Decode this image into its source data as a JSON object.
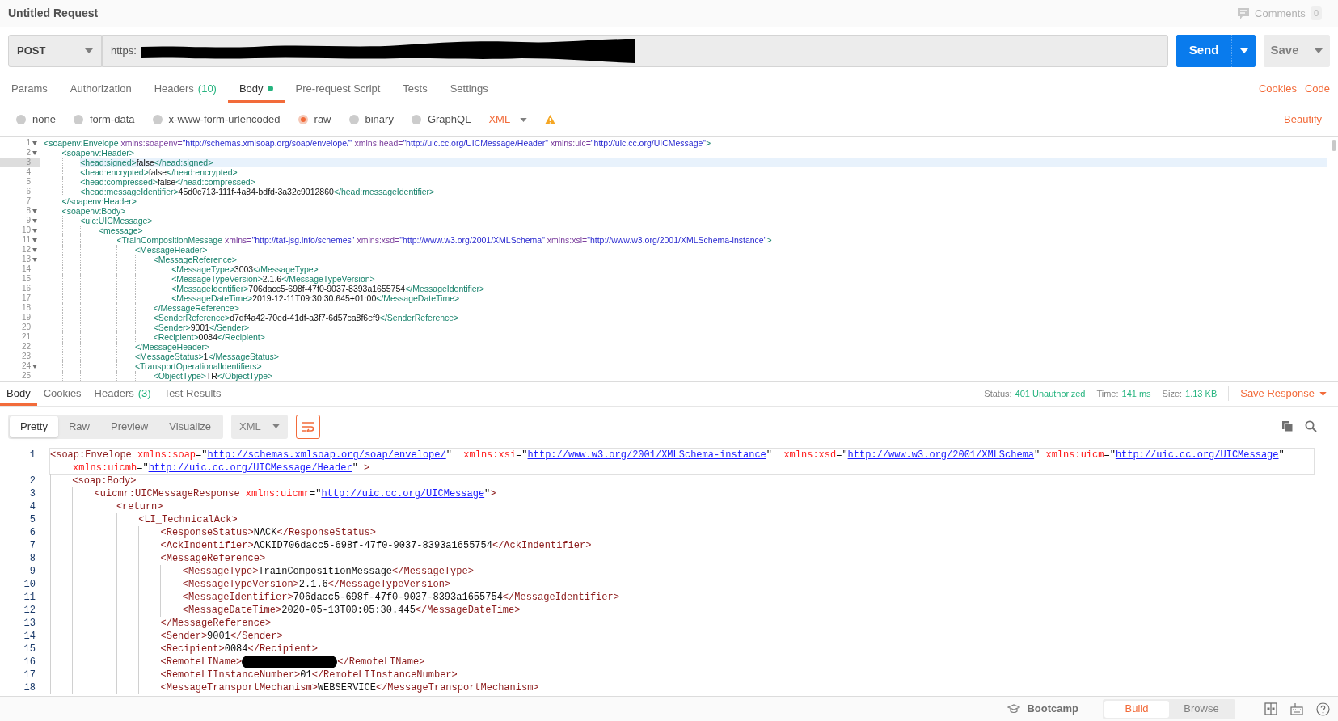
{
  "title": "Untitled Request",
  "comments": {
    "label": "Comments",
    "count": "0"
  },
  "request": {
    "method": "POST",
    "url": {
      "value": "https:",
      "redacted": true
    },
    "send": "Send",
    "save": "Save"
  },
  "tabs": [
    {
      "label": "Params",
      "selected": false
    },
    {
      "label": "Authorization",
      "selected": false
    },
    {
      "label": "Headers",
      "count": "(10)",
      "selected": false
    },
    {
      "label": "Body",
      "dot": true,
      "selected": true
    },
    {
      "label": "Pre-request Script",
      "selected": false
    },
    {
      "label": "Tests",
      "selected": false
    },
    {
      "label": "Settings",
      "selected": false
    }
  ],
  "tab_links": [
    "Cookies",
    "Code"
  ],
  "body_modes": [
    {
      "label": "none",
      "selected": false
    },
    {
      "label": "form-data",
      "selected": false
    },
    {
      "label": "x-www-form-urlencoded",
      "selected": false
    },
    {
      "label": "raw",
      "selected": true
    },
    {
      "label": "binary",
      "selected": false
    },
    {
      "label": "GraphQL",
      "selected": false
    }
  ],
  "body_format": "XML",
  "beautify": "Beautify",
  "request_code": [
    {
      "n": "1",
      "selected": false,
      "expanded": true,
      "parts": [
        {
          "kind": "tag",
          "text": "<soapenv:Envelope"
        },
        {
          "kind": "attr",
          "text": " xmlns:soapenv="
        },
        {
          "kind": "str",
          "text": "\"http://schemas.xmlsoap.org/soap/envelope/\""
        },
        {
          "kind": "attr",
          "text": " xmlns:head="
        },
        {
          "kind": "str",
          "text": "\"http://uic.cc.org/UICMessage/Header\""
        },
        {
          "kind": "attr",
          "text": " xmlns:uic="
        },
        {
          "kind": "str",
          "text": "\"http://uic.cc.org/UICMessage\""
        },
        {
          "kind": "tag",
          "text": ">"
        }
      ],
      "children": [
        {
          "n": "2",
          "selected": false,
          "expanded": true,
          "parts": [
            {
              "kind": "tag",
              "text": "<soapenv:Header>"
            }
          ],
          "children": [
            {
              "n": "3",
              "selected": true,
              "parts": [
                {
                  "kind": "tag",
                  "text": "<head:signed>"
                },
                {
                  "kind": "text",
                  "text": "false"
                },
                {
                  "kind": "tag",
                  "text": "</head:signed>"
                }
              ]
            },
            {
              "n": "4",
              "selected": false,
              "parts": [
                {
                  "kind": "tag",
                  "text": "<head:encrypted>"
                },
                {
                  "kind": "text",
                  "text": "false"
                },
                {
                  "kind": "tag",
                  "text": "</head:encrypted>"
                }
              ]
            },
            {
              "n": "5",
              "selected": false,
              "parts": [
                {
                  "kind": "tag",
                  "text": "<head:compressed>"
                },
                {
                  "kind": "text",
                  "text": "false"
                },
                {
                  "kind": "tag",
                  "text": "</head:compressed>"
                }
              ]
            },
            {
              "n": "6",
              "selected": false,
              "parts": [
                {
                  "kind": "tag",
                  "text": "<head:messageIdentifier>"
                },
                {
                  "kind": "text",
                  "text": "45d0c713-111f-4a84-bdfd-3a32c9012860"
                },
                {
                  "kind": "tag",
                  "text": "</head:messageIdentifier>"
                }
              ]
            }
          ]
        },
        {
          "n": "7",
          "selected": false,
          "parts": [
            {
              "kind": "tag",
              "text": "</soapenv:Header>"
            }
          ]
        },
        {
          "n": "8",
          "selected": false,
          "expanded": true,
          "parts": [
            {
              "kind": "tag",
              "text": "<soapenv:Body>"
            }
          ],
          "children": [
            {
              "n": "9",
              "selected": false,
              "expanded": true,
              "parts": [
                {
                  "kind": "tag",
                  "text": "<uic:UICMessage>"
                }
              ],
              "children": [
                {
                  "n": "10",
                  "selected": false,
                  "expanded": true,
                  "parts": [
                    {
                      "kind": "tag",
                      "text": "<message>"
                    }
                  ],
                  "children": [
                    {
                      "n": "11",
                      "selected": false,
                      "expanded": true,
                      "parts": [
                        {
                          "kind": "tag",
                          "text": "<TrainCompositionMessage"
                        },
                        {
                          "kind": "attr",
                          "text": " xmlns="
                        },
                        {
                          "kind": "str",
                          "text": "\"http://taf-jsg.info/schemes\""
                        },
                        {
                          "kind": "attr",
                          "text": " xmlns:xsd="
                        },
                        {
                          "kind": "str",
                          "text": "\"http://www.w3.org/2001/XMLSchema\""
                        },
                        {
                          "kind": "attr",
                          "text": " xmlns:xsi="
                        },
                        {
                          "kind": "str",
                          "text": "\"http://www.w3.org/2001/XMLSchema-instance\""
                        },
                        {
                          "kind": "tag",
                          "text": ">"
                        }
                      ],
                      "children": [
                        {
                          "n": "12",
                          "selected": false,
                          "expanded": true,
                          "parts": [
                            {
                              "kind": "tag",
                              "text": "<MessageHeader>"
                            }
                          ],
                          "children": [
                            {
                              "n": "13",
                              "selected": false,
                              "expanded": true,
                              "parts": [
                                {
                                  "kind": "tag",
                                  "text": "<MessageReference>"
                                }
                              ],
                              "children": [
                                {
                                  "n": "14",
                                  "selected": false,
                                  "parts": [
                                    {
                                      "kind": "tag",
                                      "text": "<MessageType>"
                                    },
                                    {
                                      "kind": "text",
                                      "text": "3003"
                                    },
                                    {
                                      "kind": "tag",
                                      "text": "</MessageType>"
                                    }
                                  ]
                                },
                                {
                                  "n": "15",
                                  "selected": false,
                                  "parts": [
                                    {
                                      "kind": "tag",
                                      "text": "<MessageTypeVersion>"
                                    },
                                    {
                                      "kind": "text",
                                      "text": "2.1.6"
                                    },
                                    {
                                      "kind": "tag",
                                      "text": "</MessageTypeVersion>"
                                    }
                                  ]
                                },
                                {
                                  "n": "16",
                                  "selected": false,
                                  "parts": [
                                    {
                                      "kind": "tag",
                                      "text": "<MessageIdentifier>"
                                    },
                                    {
                                      "kind": "text",
                                      "text": "706dacc5-698f-47f0-9037-8393a1655754"
                                    },
                                    {
                                      "kind": "tag",
                                      "text": "</MessageIdentifier>"
                                    }
                                  ]
                                },
                                {
                                  "n": "17",
                                  "selected": false,
                                  "parts": [
                                    {
                                      "kind": "tag",
                                      "text": "<MessageDateTime>"
                                    },
                                    {
                                      "kind": "text",
                                      "text": "2019-12-11T09:30:30.645+01:00"
                                    },
                                    {
                                      "kind": "tag",
                                      "text": "</MessageDateTime>"
                                    }
                                  ]
                                }
                              ]
                            },
                            {
                              "n": "18",
                              "selected": false,
                              "parts": [
                                {
                                  "kind": "tag",
                                  "text": "</MessageReference>"
                                }
                              ]
                            },
                            {
                              "n": "19",
                              "selected": false,
                              "parts": [
                                {
                                  "kind": "tag",
                                  "text": "<SenderReference>"
                                },
                                {
                                  "kind": "text",
                                  "text": "d7df4a42-70ed-41df-a3f7-6d57ca8f6ef9"
                                },
                                {
                                  "kind": "tag",
                                  "text": "</SenderReference>"
                                }
                              ]
                            },
                            {
                              "n": "20",
                              "selected": false,
                              "parts": [
                                {
                                  "kind": "tag",
                                  "text": "<Sender>"
                                },
                                {
                                  "kind": "text",
                                  "text": "9001"
                                },
                                {
                                  "kind": "tag",
                                  "text": "</Sender>"
                                }
                              ]
                            },
                            {
                              "n": "21",
                              "selected": false,
                              "parts": [
                                {
                                  "kind": "tag",
                                  "text": "<Recipient>"
                                },
                                {
                                  "kind": "text",
                                  "text": "0084"
                                },
                                {
                                  "kind": "tag",
                                  "text": "</Recipient>"
                                }
                              ]
                            }
                          ]
                        },
                        {
                          "n": "22",
                          "selected": false,
                          "parts": [
                            {
                              "kind": "tag",
                              "text": "</MessageHeader>"
                            }
                          ]
                        },
                        {
                          "n": "23",
                          "selected": false,
                          "parts": [
                            {
                              "kind": "tag",
                              "text": "<MessageStatus>"
                            },
                            {
                              "kind": "text",
                              "text": "1"
                            },
                            {
                              "kind": "tag",
                              "text": "</MessageStatus>"
                            }
                          ]
                        },
                        {
                          "n": "24",
                          "selected": false,
                          "expanded": true,
                          "parts": [
                            {
                              "kind": "tag",
                              "text": "<TransportOperationalIdentifiers>"
                            }
                          ],
                          "children": [
                            {
                              "n": "25",
                              "selected": false,
                              "parts": [
                                {
                                  "kind": "tag",
                                  "text": "<ObjectType>"
                                },
                                {
                                  "kind": "text",
                                  "text": "TR"
                                },
                                {
                                  "kind": "tag",
                                  "text": "</ObjectType>"
                                }
                              ]
                            }
                          ]
                        }
                      ]
                    }
                  ]
                }
              ]
            }
          ]
        }
      ]
    }
  ],
  "response_tabs": [
    {
      "label": "Body",
      "selected": true
    },
    {
      "label": "Cookies",
      "selected": false
    },
    {
      "label": "Headers",
      "count": "(3)",
      "selected": false
    },
    {
      "label": "Test Results",
      "selected": false
    }
  ],
  "response_meta": [
    {
      "label": "Status:",
      "value": "401 Unauthorized"
    },
    {
      "label": "Time:",
      "value": "141 ms"
    },
    {
      "label": "Size:",
      "value": "1.13 KB"
    }
  ],
  "save_response": "Save Response",
  "view_modes": [
    {
      "label": "Pretty",
      "selected": true
    },
    {
      "label": "Raw",
      "selected": false
    },
    {
      "label": "Preview",
      "selected": false
    },
    {
      "label": "Visualize",
      "selected": false
    }
  ],
  "response_format": "XML",
  "response_code": [
    {
      "n": "1",
      "selected": true,
      "parts": [
        {
          "kind": "tag",
          "text": "<soap:Envelope"
        },
        {
          "kind": "attr",
          "text": " xmlns:soap"
        },
        {
          "kind": "eq",
          "text": "=\""
        },
        {
          "kind": "link",
          "text": "http://schemas.xmlsoap.org/soap/envelope/"
        },
        {
          "kind": "eq",
          "text": "\""
        },
        {
          "kind": "attr",
          "text": "  xmlns:xsi"
        },
        {
          "kind": "eq",
          "text": "=\""
        },
        {
          "kind": "link",
          "text": "http://www.w3.org/2001/XMLSchema-instance"
        },
        {
          "kind": "eq",
          "text": "\""
        },
        {
          "kind": "attr",
          "text": "  xmlns:xsd"
        },
        {
          "kind": "eq",
          "text": "=\""
        },
        {
          "kind": "link",
          "text": "http://www.w3.org/2001/XMLSchema"
        },
        {
          "kind": "eq",
          "text": "\""
        },
        {
          "kind": "attr",
          "text": " xmlns:uicm"
        },
        {
          "kind": "eq",
          "text": "=\""
        },
        {
          "kind": "link",
          "text": "http://uic.cc.org/UICMessage"
        },
        {
          "kind": "eq",
          "text": "\""
        },
        {
          "kind": "attr",
          "text": " xmlns:uicmh"
        },
        {
          "kind": "eq",
          "text": "=\""
        },
        {
          "kind": "link",
          "text": "http://uic.cc.org/UICMessage/Header"
        },
        {
          "kind": "eq",
          "text": "\" "
        },
        {
          "kind": "tag",
          "text": ">"
        }
      ],
      "children": [
        {
          "n": "2",
          "selected": false,
          "parts": [
            {
              "kind": "tag",
              "text": "<soap:Body>"
            }
          ],
          "children": [
            {
              "n": "3",
              "selected": false,
              "parts": [
                {
                  "kind": "tag",
                  "text": "<uicmr:UICMessageResponse"
                },
                {
                  "kind": "attr",
                  "text": " xmlns:uicmr"
                },
                {
                  "kind": "eq",
                  "text": "=\""
                },
                {
                  "kind": "link",
                  "text": "http://uic.cc.org/UICMessage"
                },
                {
                  "kind": "eq",
                  "text": "\""
                },
                {
                  "kind": "tag",
                  "text": ">"
                }
              ],
              "children": [
                {
                  "n": "4",
                  "selected": false,
                  "parts": [
                    {
                      "kind": "tag",
                      "text": "<return>"
                    }
                  ],
                  "children": [
                    {
                      "n": "5",
                      "selected": false,
                      "parts": [
                        {
                          "kind": "tag",
                          "text": "<LI_TechnicalAck>"
                        }
                      ],
                      "children": [
                        {
                          "n": "6",
                          "selected": false,
                          "parts": [
                            {
                              "kind": "tag",
                              "text": "<ResponseStatus>"
                            },
                            {
                              "kind": "text",
                              "text": "NACK"
                            },
                            {
                              "kind": "tag",
                              "text": "</ResponseStatus>"
                            }
                          ]
                        },
                        {
                          "n": "7",
                          "selected": false,
                          "parts": [
                            {
                              "kind": "tag",
                              "text": "<AckIndentifier>"
                            },
                            {
                              "kind": "text",
                              "text": "ACKID706dacc5-698f-47f0-9037-8393a1655754"
                            },
                            {
                              "kind": "tag",
                              "text": "</AckIndentifier>"
                            }
                          ]
                        },
                        {
                          "n": "8",
                          "selected": false,
                          "parts": [
                            {
                              "kind": "tag",
                              "text": "<MessageReference>"
                            }
                          ],
                          "children": [
                            {
                              "n": "9",
                              "selected": false,
                              "parts": [
                                {
                                  "kind": "tag",
                                  "text": "<MessageType>"
                                },
                                {
                                  "kind": "text",
                                  "text": "TrainCompositionMessage"
                                },
                                {
                                  "kind": "tag",
                                  "text": "</MessageType>"
                                }
                              ]
                            },
                            {
                              "n": "10",
                              "selected": false,
                              "parts": [
                                {
                                  "kind": "tag",
                                  "text": "<MessageTypeVersion>"
                                },
                                {
                                  "kind": "text",
                                  "text": "2.1.6"
                                },
                                {
                                  "kind": "tag",
                                  "text": "</MessageTypeVersion>"
                                }
                              ]
                            },
                            {
                              "n": "11",
                              "selected": false,
                              "parts": [
                                {
                                  "kind": "tag",
                                  "text": "<MessageIdentifier>"
                                },
                                {
                                  "kind": "text",
                                  "text": "706dacc5-698f-47f0-9037-8393a1655754"
                                },
                                {
                                  "kind": "tag",
                                  "text": "</MessageIdentifier>"
                                }
                              ]
                            },
                            {
                              "n": "12",
                              "selected": false,
                              "parts": [
                                {
                                  "kind": "tag",
                                  "text": "<MessageDateTime>"
                                },
                                {
                                  "kind": "text",
                                  "text": "2020-05-13T00:05:30.445"
                                },
                                {
                                  "kind": "tag",
                                  "text": "</MessageDateTime>"
                                }
                              ]
                            }
                          ]
                        },
                        {
                          "n": "13",
                          "selected": false,
                          "parts": [
                            {
                              "kind": "tag",
                              "text": "</MessageReference>"
                            }
                          ]
                        },
                        {
                          "n": "14",
                          "selected": false,
                          "parts": [
                            {
                              "kind": "tag",
                              "text": "<Sender>"
                            },
                            {
                              "kind": "text",
                              "text": "9001"
                            },
                            {
                              "kind": "tag",
                              "text": "</Sender>"
                            }
                          ]
                        },
                        {
                          "n": "15",
                          "selected": false,
                          "parts": [
                            {
                              "kind": "tag",
                              "text": "<Recipient>"
                            },
                            {
                              "kind": "text",
                              "text": "0084"
                            },
                            {
                              "kind": "tag",
                              "text": "</Recipient>"
                            }
                          ]
                        },
                        {
                          "n": "16",
                          "selected": false,
                          "parts": [
                            {
                              "kind": "tag",
                              "text": "<RemoteLIName>"
                            },
                            {
                              "kind": "redacted"
                            },
                            {
                              "kind": "tag",
                              "text": "</RemoteLIName>"
                            }
                          ]
                        },
                        {
                          "n": "17",
                          "selected": false,
                          "parts": [
                            {
                              "kind": "tag",
                              "text": "<RemoteLIInstanceNumber>"
                            },
                            {
                              "kind": "text",
                              "text": "01"
                            },
                            {
                              "kind": "tag",
                              "text": "</RemoteLIInstanceNumber>"
                            }
                          ]
                        },
                        {
                          "n": "18",
                          "selected": false,
                          "parts": [
                            {
                              "kind": "tag",
                              "text": "<MessageTransportMechanism>"
                            },
                            {
                              "kind": "text",
                              "text": "WEBSERVICE"
                            },
                            {
                              "kind": "tag",
                              "text": "</MessageTransportMechanism>"
                            }
                          ]
                        }
                      ]
                    }
                  ]
                }
              ]
            }
          ]
        }
      ]
    }
  ],
  "footer": {
    "bootcamp": "Bootcamp",
    "modes": [
      {
        "label": "Build",
        "selected": true
      },
      {
        "label": "Browse",
        "selected": false
      }
    ]
  }
}
